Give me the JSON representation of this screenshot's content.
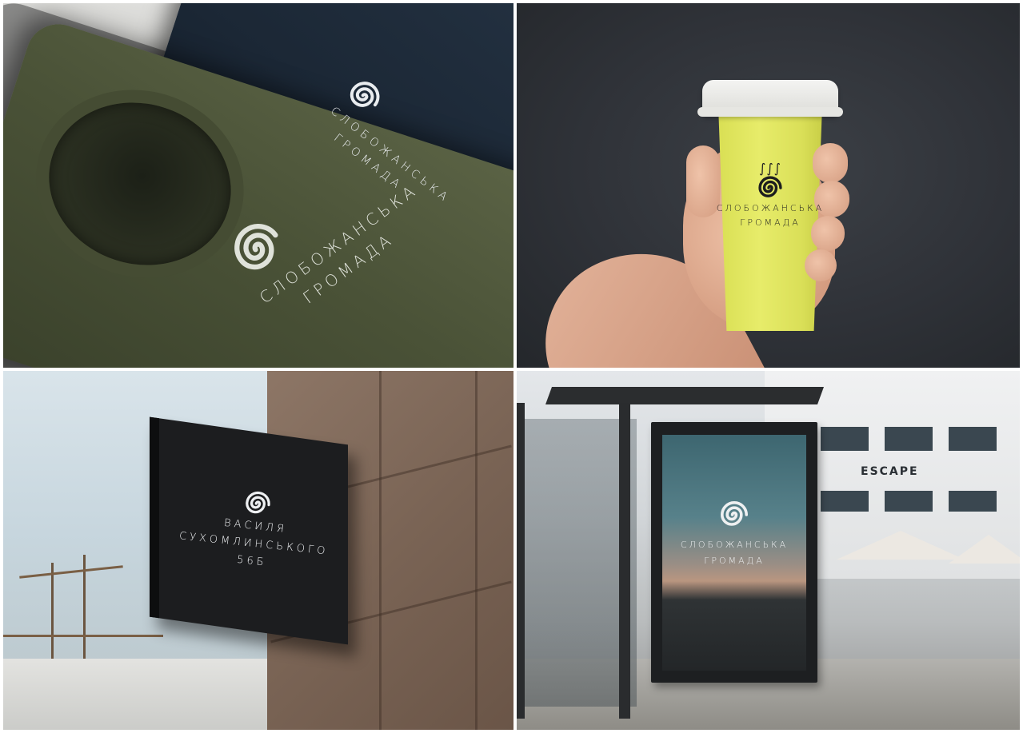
{
  "brand": {
    "line1": "Слобожанська",
    "line2": "громада"
  },
  "sign": {
    "line1": "Василя",
    "line2": "Сухомлинського",
    "line3": "56б"
  },
  "storefront": {
    "name": "ESCAPE"
  },
  "colors": {
    "cup": "#e4ea62",
    "shirt_olive": "#4a5237",
    "shirt_navy": "#1b2735",
    "sign": "#1c1d1f"
  }
}
